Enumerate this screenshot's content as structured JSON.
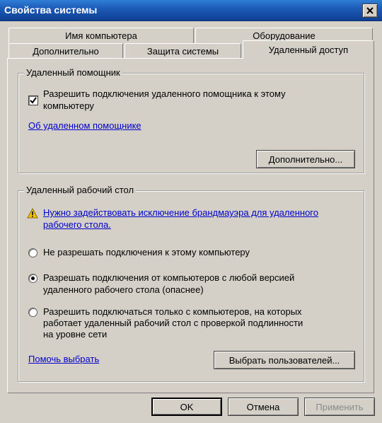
{
  "window": {
    "title": "Свойства системы"
  },
  "tabs": {
    "row_back": [
      "Имя компьютера",
      "Оборудование"
    ],
    "row_front": [
      "Дополнительно",
      "Защита системы",
      "Удаленный доступ"
    ]
  },
  "assistance": {
    "legend": "Удаленный помощник",
    "allow_checkbox_label_line1": "Разрешить подключения удаленного помощника к этому",
    "allow_checkbox_label_line2": "компьютеру",
    "allow_checked": true,
    "about_link": "Об удаленном помощнике",
    "advanced_button": "Дополнительно..."
  },
  "desktop": {
    "legend": "Удаленный рабочий стол",
    "firewall_warning_line1": "Нужно задействовать исключение брандмауэра для удаленного",
    "firewall_warning_line2": "рабочего стола.",
    "options": [
      {
        "line1": "Не разрешать подключения к этому компьютеру",
        "line2": "",
        "line3": "",
        "selected": false
      },
      {
        "line1": "Разрешать подключения от компьютеров с любой версией",
        "line2": "удаленного рабочего стола (опаснее)",
        "line3": "",
        "selected": true
      },
      {
        "line1": "Разрешить подключаться только с компьютеров, на которых",
        "line2": "работает удаленный рабочий стол с проверкой подлинности",
        "line3": "на уровне сети",
        "selected": false
      }
    ],
    "help_link": "Помочь выбрать",
    "select_users_button": "Выбрать пользователей..."
  },
  "footer": {
    "ok": "OK",
    "cancel": "Отмена",
    "apply": "Применить"
  },
  "icons": {
    "close": "close-icon",
    "warning": "warning-icon",
    "checkmark": "checkmark-icon"
  }
}
